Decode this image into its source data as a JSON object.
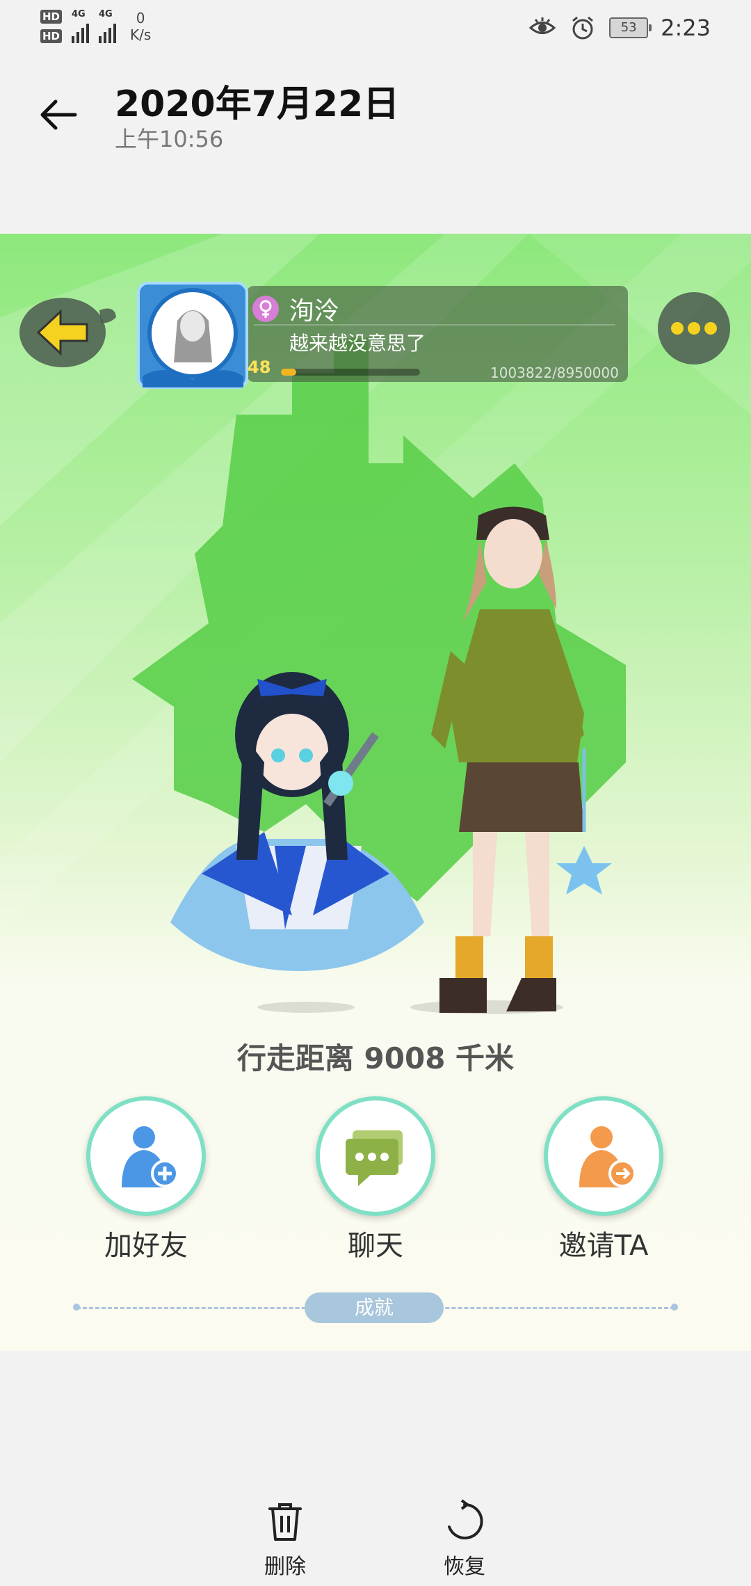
{
  "status_bar": {
    "hd1": "HD",
    "hd2": "HD",
    "net1": "4G",
    "net2": "4G",
    "speed_value": "0",
    "speed_unit": "K/s",
    "battery": "53",
    "time": "2:23"
  },
  "header": {
    "title": "2020年7月22日",
    "subtitle": "上午10:56"
  },
  "profile": {
    "username": "洵泠",
    "signature": "越来越没意思了",
    "level": "48",
    "level_progress": 0.112,
    "exp": "1003822/8950000"
  },
  "game": {
    "distance": "行走距离 9008 千米",
    "actions": [
      {
        "label": "加好友"
      },
      {
        "label": "聊天"
      },
      {
        "label": "邀请TA"
      }
    ],
    "achievements_label": "成就"
  },
  "toolbar": {
    "delete_label": "删除",
    "restore_label": "恢复"
  },
  "colors": {
    "accent_green": "#6fd85e",
    "ring": "#7fe0c5",
    "gender_pink": "#d77ed6",
    "level_yellow": "#f2b521"
  }
}
